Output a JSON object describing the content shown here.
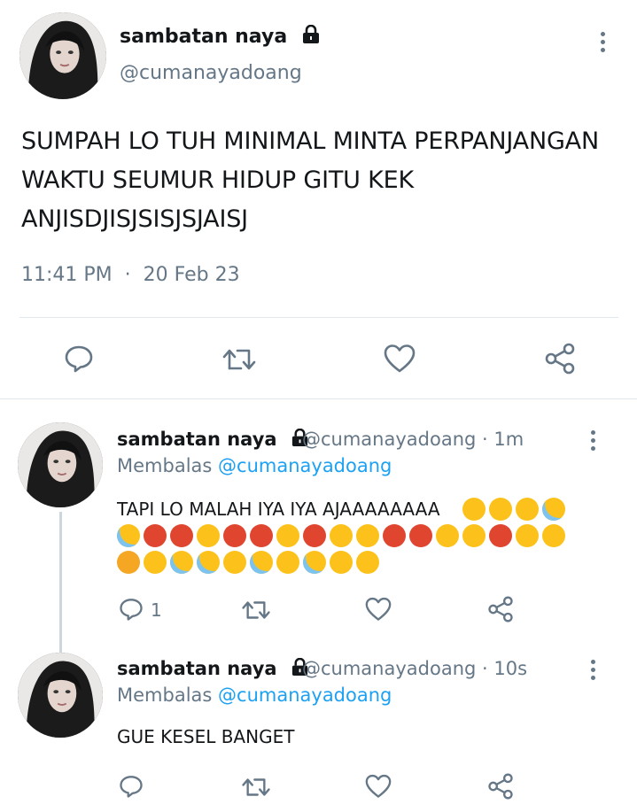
{
  "main_tweet": {
    "display_name": "sambatan naya",
    "handle": "@cumanayadoang",
    "text": "SUMPAH LO TUH MINIMAL MINTA PERPANJANGAN WAKTU SEUMUR HIDUP GITU KEK ANJISDJISJSISJSJAISJ",
    "time": "11:41 PM",
    "separator": "·",
    "date": "20 Feb 23"
  },
  "replies": [
    {
      "display_name": "sambatan naya",
      "handle_time": "@cumanayadoang · 1m",
      "replying_label": "Membalas",
      "replying_mention": "@cumanayadoang",
      "text": "TAPI LO MALAH IYA IYA AJAAAAAAAA",
      "reply_count": "1"
    },
    {
      "display_name": "sambatan naya",
      "handle_time": "@cumanayadoang · 10s",
      "replying_label": "Membalas",
      "replying_mention": "@cumanayadoang",
      "text": "GUE KESEL BANGET"
    }
  ],
  "icons": {
    "reply": "reply-icon",
    "retweet": "retweet-icon",
    "like": "heart-icon",
    "share": "share-icon",
    "lock": "lock-icon",
    "more": "more-vertical-icon"
  },
  "colors": {
    "text": "#14171a",
    "secondary": "#657786",
    "accent": "#1da1f2",
    "divider": "#e1e8ed"
  }
}
